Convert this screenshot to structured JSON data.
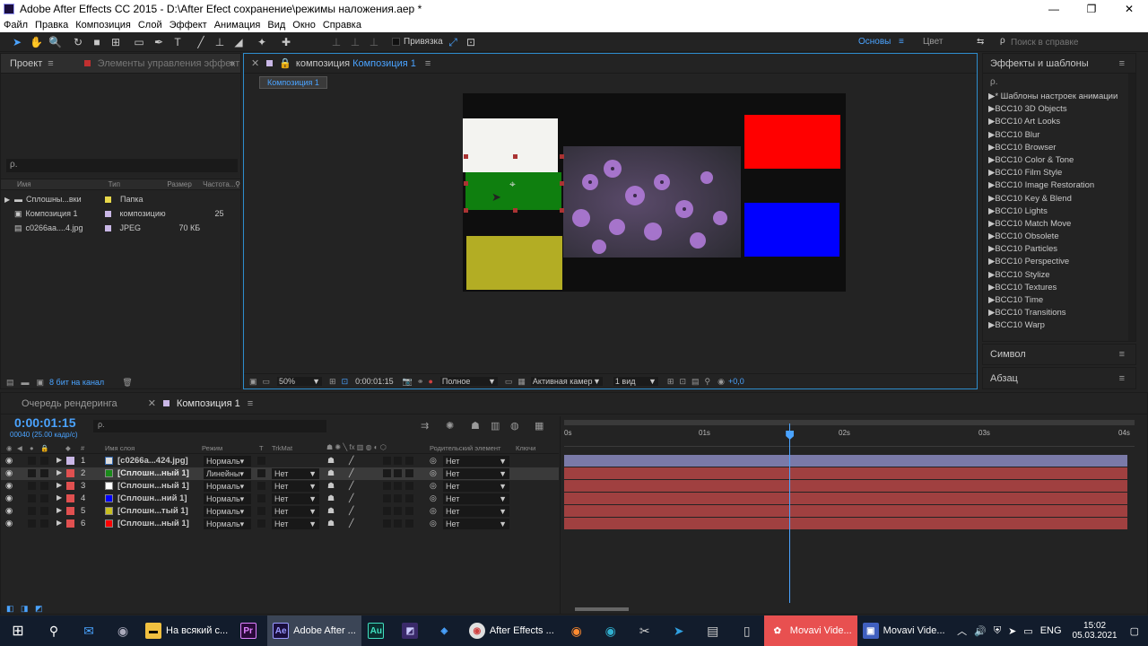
{
  "window": {
    "title": "Adobe After Effects CC 2015 - D:\\After Efect сохранение\\режимы наложения.aep *",
    "minimize": "—",
    "maximize": "❐",
    "close": "✕"
  },
  "menu": [
    "Файл",
    "Правка",
    "Композиция",
    "Слой",
    "Эффект",
    "Анимация",
    "Вид",
    "Окно",
    "Справка"
  ],
  "toolbar": {
    "snap_label": "Привязка",
    "workspace": "Основы",
    "color_ws": "Цвет",
    "help_search": "Поиск в справке"
  },
  "project_panel": {
    "tab_project": "Проект",
    "tab_effects_controls": "Элементы управления эффект",
    "search_placeholder": "ρ.",
    "columns": [
      "Имя",
      "Тип",
      "Размер",
      "Частота..."
    ],
    "items": [
      {
        "name": "Сплошны...вки",
        "type": "Папка",
        "size": "",
        "rate": "",
        "color": "#e8d84a"
      },
      {
        "name": "Композиция 1",
        "type": "композицию",
        "size": "",
        "rate": "25",
        "color": "#c9b7e6"
      },
      {
        "name": "c0266aa....4.jpg",
        "type": "JPEG",
        "size": "70 КБ",
        "rate": "",
        "color": "#c9b7e6"
      }
    ],
    "bit_depth": "8 бит на канал"
  },
  "comp_panel": {
    "tab_prefix": "композиция",
    "tab_name": "Композиция 1",
    "subtab": "Композиция 1",
    "zoom": "50%",
    "timecode": "0:00:01:15",
    "resolution": "Полное",
    "camera": "Активная камер",
    "views": "1 вид",
    "exposure": "+0,0"
  },
  "effects_panel": {
    "title": "Эффекты и шаблоны",
    "search_placeholder": "ρ.",
    "items": [
      "* Шаблоны настроек анимации",
      "BCC10 3D Objects",
      "BCC10 Art Looks",
      "BCC10 Blur",
      "BCC10 Browser",
      "BCC10 Color & Tone",
      "BCC10 Film Style",
      "BCC10 Image Restoration",
      "BCC10 Key & Blend",
      "BCC10 Lights",
      "BCC10 Match Move",
      "BCC10 Obsolete",
      "BCC10 Particles",
      "BCC10 Perspective",
      "BCC10 Stylize",
      "BCC10 Textures",
      "BCC10 Time",
      "BCC10 Transitions",
      "BCC10 Warp"
    ],
    "symbol": "Символ",
    "paragraph": "Абзац"
  },
  "timeline": {
    "tab_render": "Очередь рендеринга",
    "tab_comp": "Композиция 1",
    "timecode": "0:00:01:15",
    "frame_info": "00040 (25.00 кадр/с)",
    "columns": {
      "name": "Имя слоя",
      "mode": "Режим",
      "t": "T",
      "trkmat": "TrkMat",
      "parent": "Родительский элемент",
      "keys": "Ключи"
    },
    "ruler": [
      "0s",
      "01s",
      "02s",
      "03s",
      "04s"
    ],
    "playhead_fraction": 0.4,
    "layers": [
      {
        "num": "1",
        "name": "[c0266a...424.jpg]",
        "mode": "Нормаль",
        "trkmat": "",
        "parent": "Нет",
        "color": "#c9b7e6",
        "swatch": "#c9b7e6"
      },
      {
        "num": "2",
        "name": "[Сплошн...ный 1]",
        "mode": "Линейны",
        "trkmat": "Нет",
        "parent": "Нет",
        "color": "#e05050",
        "swatch": "#1a8a1a"
      },
      {
        "num": "3",
        "name": "[Сплошн...ный 1]",
        "mode": "Нормаль",
        "trkmat": "Нет",
        "parent": "Нет",
        "color": "#e05050",
        "swatch": "#ffffff"
      },
      {
        "num": "4",
        "name": "[Сплошн...ний 1]",
        "mode": "Нормаль",
        "trkmat": "Нет",
        "parent": "Нет",
        "color": "#e05050",
        "swatch": "#0000ff"
      },
      {
        "num": "5",
        "name": "[Сплошн...тый 1]",
        "mode": "Нормаль",
        "trkmat": "Нет",
        "parent": "Нет",
        "color": "#e05050",
        "swatch": "#c8c020"
      },
      {
        "num": "6",
        "name": "[Сплошн...ный 1]",
        "mode": "Нормаль",
        "trkmat": "Нет",
        "parent": "Нет",
        "color": "#e05050",
        "swatch": "#ff0000"
      }
    ]
  },
  "taskbar": {
    "items": [
      {
        "label": "На всякий с...",
        "icon": "folder-icon",
        "color": "#f0c040"
      },
      {
        "label": "",
        "icon": "premiere-icon",
        "color": "#2a0a3a"
      },
      {
        "label": "Adobe After ...",
        "icon": "after-effects-icon",
        "color": "#1a0e3d"
      },
      {
        "label": "",
        "icon": "audition-icon",
        "color": "#0a3030"
      },
      {
        "label": "",
        "icon": "app-icon",
        "color": "#3a2a6a"
      },
      {
        "label": "",
        "icon": "app-icon-2",
        "color": "#1a6ab0"
      },
      {
        "label": "After Effects ...",
        "icon": "chrome-icon",
        "color": "#e0e0e0"
      },
      {
        "label": "Movavi Vide...",
        "icon": "movavi-icon",
        "color": "#e85050"
      },
      {
        "label": "Movavi Vide...",
        "icon": "movavi-editor-icon",
        "color": "#4060c0"
      }
    ],
    "lang": "ENG",
    "time": "15:02",
    "date": "05.03.2021"
  }
}
